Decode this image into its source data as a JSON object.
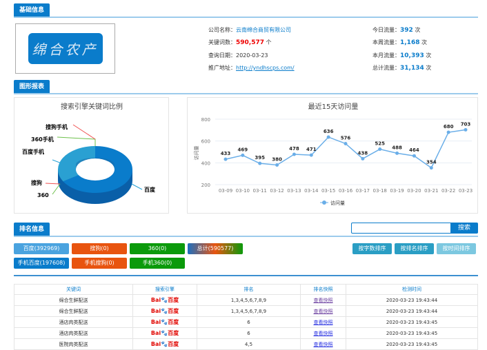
{
  "sections": {
    "basic": "基础信息",
    "charts": "图形报表",
    "ranking": "排名信息"
  },
  "logo_text": "绵合农产",
  "info": {
    "company": {
      "label": "公司名称：",
      "value": "云南绵合商贸有限公司"
    },
    "keywords": {
      "label": "关键词数：",
      "value": "590,577",
      "unit": "个"
    },
    "date": {
      "label": "查询日期：",
      "value": "2020-03-23"
    },
    "url": {
      "label": "推广地址：",
      "value": "http://yndhscps.com/"
    },
    "today": {
      "label": "今日流量：",
      "value": "392",
      "unit": "次"
    },
    "week": {
      "label": "本周流量：",
      "value": "1,168",
      "unit": "次"
    },
    "month": {
      "label": "本月流量：",
      "value": "10,393",
      "unit": "次"
    },
    "total": {
      "label": "总计流量：",
      "value": "31,134",
      "unit": "次"
    }
  },
  "chart_data": [
    {
      "type": "pie",
      "title": "搜索引擎关键词比例",
      "categories": [
        "百度",
        "搜狗",
        "360",
        "百度手机",
        "360手机",
        "搜狗手机"
      ],
      "values": [
        392969,
        0,
        0,
        197608,
        0,
        0
      ],
      "colors": [
        "#0a7ccb",
        "#f05050",
        "#6cc04a",
        "#29a3d6",
        "#6cc04a",
        "#f05050"
      ]
    },
    {
      "type": "line",
      "title": "最近15天访问量",
      "ylabel": "访问量",
      "legend": "访问量",
      "x": [
        "03-09",
        "03-10",
        "03-11",
        "03-12",
        "03-13",
        "03-14",
        "03-15",
        "03-16",
        "03-17",
        "03-18",
        "03-19",
        "03-20",
        "03-21",
        "03-22",
        "03-23"
      ],
      "values": [
        433,
        469,
        395,
        380,
        478,
        471,
        636,
        576,
        438,
        525,
        488,
        464,
        354,
        680,
        703
      ],
      "ylim": [
        200,
        800
      ],
      "yticks": [
        "200",
        "400",
        "600",
        "800"
      ]
    }
  ],
  "search": {
    "placeholder": "",
    "button": "搜索"
  },
  "filters": [
    {
      "label": "百度(392969)",
      "color": "#4aa3df"
    },
    {
      "label": "搜狗(0)",
      "color": "#e8540f"
    },
    {
      "label": "360(0)",
      "color": "#0b9a0b"
    },
    {
      "label": "总计(590577)",
      "color": "linear-gradient(90deg,#1d6fc0,#e8540f,#0b9a0b)"
    },
    {
      "label": "手机百度(197608)",
      "color": "#0a7ccb"
    },
    {
      "label": "手机搜狗(0)",
      "color": "#e8540f"
    },
    {
      "label": "手机360(0)",
      "color": "#0b9a0b"
    }
  ],
  "sort_buttons": [
    {
      "label": "按字数排序",
      "color": "#2a9ec4"
    },
    {
      "label": "按排名排序",
      "color": "#2a9ec4"
    },
    {
      "label": "按时间排序",
      "color": "#7cc8e0"
    }
  ],
  "table": {
    "headers": [
      "关键词",
      "搜索引擎",
      "排名",
      "排名快照",
      "检测时间"
    ],
    "engine_logo": {
      "a": "Bai",
      "b": "百度"
    },
    "rows": [
      {
        "kw": "绵合生鲜配送",
        "rank": "1,3,4,5,6,7,8,9",
        "snap": "查看快照",
        "time": "2020-03-23 19:43:44"
      },
      {
        "kw": "绵合生鲜配送",
        "rank": "1,3,4,5,6,7,8,9",
        "snap": "查看快照",
        "time": "2020-03-23 19:43:44"
      },
      {
        "kw": "酒店肉类配送",
        "rank": "6",
        "snap": "查看快照",
        "time": "2020-03-23 19:43:45"
      },
      {
        "kw": "酒店肉类配送",
        "rank": "6",
        "snap": "查看快照",
        "time": "2020-03-23 19:43:45"
      },
      {
        "kw": "医院肉类配送",
        "rank": "4,5",
        "snap": "查看快照",
        "time": "2020-03-23 19:43:45"
      }
    ]
  }
}
